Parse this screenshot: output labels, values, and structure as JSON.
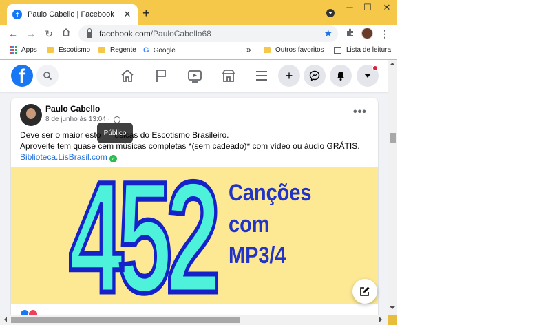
{
  "browser": {
    "tab_title": "Paulo Cabello | Facebook",
    "tab_favicon_letter": "f",
    "new_tab": "+",
    "url_host": "facebook.com",
    "url_path": "/PauloCabello68",
    "bookmarks": {
      "apps": "Apps",
      "escotismo": "Escotismo",
      "regente": "Regente",
      "google": "Google",
      "overflow": "»",
      "outros": "Outros favoritos",
      "leitura": "Lista de leitura"
    }
  },
  "facebook": {
    "logo_letter": "f",
    "post": {
      "author": "Paulo Cabello",
      "date": "8 de junho às 13:04 ·",
      "line1": "Deve ser o maior esto      úsicas do Escotismo Brasileiro.",
      "line2": "Aproveite tem quase cem músicas completas *(sem cadeado)* com vídeo ou áudio GRÁTIS.",
      "link": "Biblioteca.LisBrasil.com",
      "tooltip": "Público",
      "image": {
        "number": "452",
        "line1": "Canções",
        "line2": "com",
        "line3": "MP3/4"
      }
    }
  },
  "colors": {
    "facebook_blue": "#1877f2",
    "chrome_frame": "#f5c84a",
    "image_bg": "#fde994",
    "image_text": "#2234c8",
    "number_fill": "#4ef2da"
  }
}
